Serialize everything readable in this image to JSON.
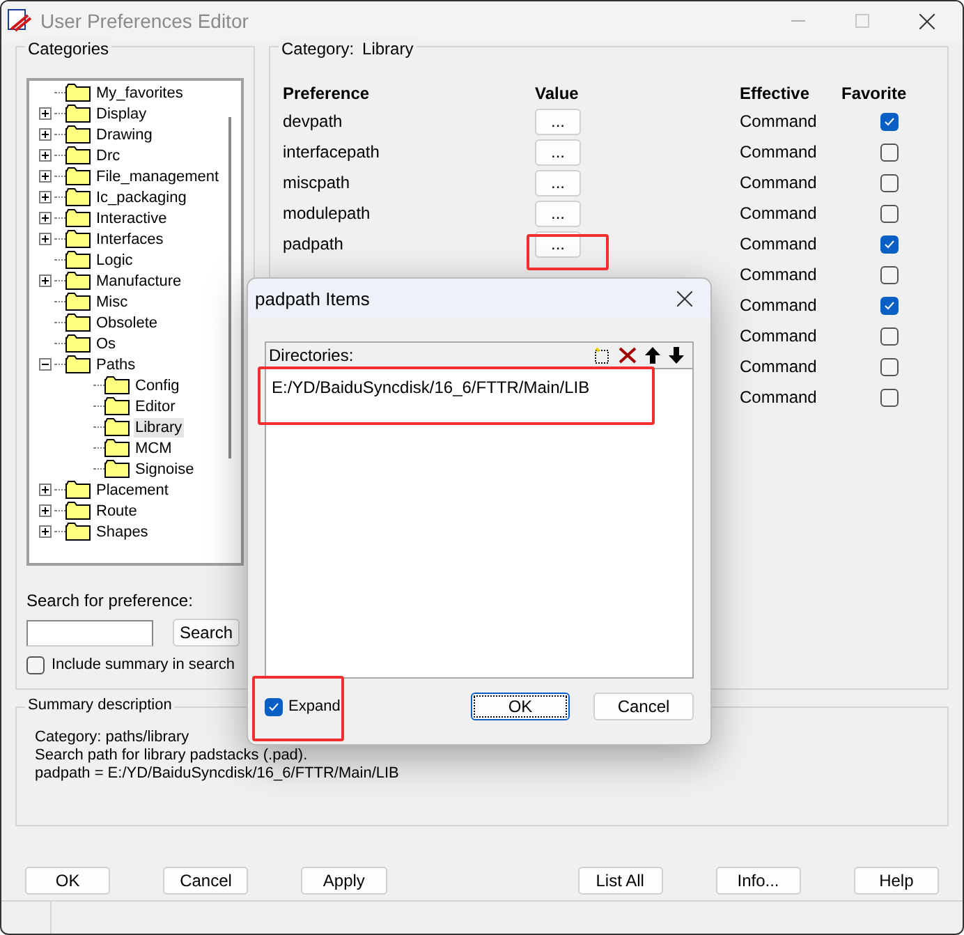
{
  "window": {
    "title": "User Preferences Editor"
  },
  "categories": {
    "title": "Categories",
    "tree": [
      {
        "label": "My_favorites",
        "selected": false
      },
      {
        "label": "Display",
        "selected": false,
        "expanded": false
      },
      {
        "label": "Drawing",
        "selected": false,
        "expanded": false
      },
      {
        "label": "Drc",
        "selected": false,
        "expanded": false
      },
      {
        "label": "File_management",
        "selected": false,
        "expanded": false
      },
      {
        "label": "Ic_packaging",
        "selected": false,
        "expanded": false
      },
      {
        "label": "Interactive",
        "selected": false,
        "expanded": false
      },
      {
        "label": "Interfaces",
        "selected": false,
        "expanded": false
      },
      {
        "label": "Logic",
        "selected": false
      },
      {
        "label": "Manufacture",
        "selected": false,
        "expanded": false
      },
      {
        "label": "Misc",
        "selected": false
      },
      {
        "label": "Obsolete",
        "selected": false
      },
      {
        "label": "Os",
        "selected": false
      },
      {
        "label": "Paths",
        "selected": false,
        "expanded": true,
        "children": [
          {
            "label": "Config",
            "selected": false
          },
          {
            "label": "Editor",
            "selected": false
          },
          {
            "label": "Library",
            "selected": true
          },
          {
            "label": "MCM",
            "selected": false
          },
          {
            "label": "Signoise",
            "selected": false
          }
        ]
      },
      {
        "label": "Placement",
        "selected": false,
        "expanded": false
      },
      {
        "label": "Route",
        "selected": false,
        "expanded": false
      },
      {
        "label": "Shapes",
        "selected": false,
        "expanded": false
      }
    ]
  },
  "search": {
    "label": "Search for preference:",
    "button": "Search",
    "include_summary": {
      "label": "Include summary in search",
      "checked": false
    }
  },
  "category_panel": {
    "label": "Category:",
    "value": "Library",
    "columns": [
      "Preference",
      "Value",
      "Effective",
      "Favorite"
    ],
    "rows": [
      {
        "name": "devpath",
        "value_button": "...",
        "effective": "Command",
        "favorite": true
      },
      {
        "name": "interfacepath",
        "value_button": "...",
        "effective": "Command",
        "favorite": false
      },
      {
        "name": "miscpath",
        "value_button": "...",
        "effective": "Command",
        "favorite": false
      },
      {
        "name": "modulepath",
        "value_button": "...",
        "effective": "Command",
        "favorite": false
      },
      {
        "name": "padpath",
        "value_button": "...",
        "effective": "Command",
        "favorite": true
      },
      {
        "effective": "Command",
        "favorite": false
      },
      {
        "effective": "Command",
        "favorite": true
      },
      {
        "effective": "Command",
        "favorite": false
      },
      {
        "effective": "Command",
        "favorite": false
      },
      {
        "effective": "Command",
        "favorite": false
      }
    ]
  },
  "summary": {
    "title": "Summary description",
    "lines": [
      "Category: paths/library",
      "Search path for library padstacks (.pad).",
      "padpath = E:/YD/BaiduSyncdisk/16_6/FTTR/Main/LIB"
    ]
  },
  "buttons": [
    "OK",
    "Cancel",
    "Apply",
    "List All",
    "Info...",
    "Help"
  ],
  "dialog": {
    "title": "padpath Items",
    "list_label": "Directories:",
    "items": [
      "E:/YD/BaiduSyncdisk/16_6/FTTR/Main/LIB"
    ],
    "expand": {
      "label": "Expand",
      "checked": true
    },
    "ok": "OK",
    "cancel": "Cancel"
  }
}
